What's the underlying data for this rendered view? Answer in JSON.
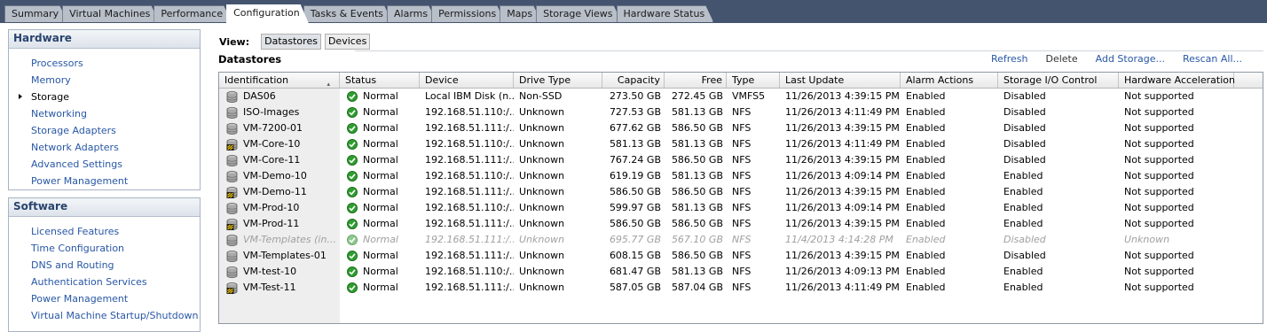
{
  "tabs": [
    "Summary",
    "Virtual Machines",
    "Performance",
    "Configuration",
    "Tasks & Events",
    "Alarms",
    "Permissions",
    "Maps",
    "Storage Views",
    "Hardware Status"
  ],
  "active_tab": "Configuration",
  "hardware": {
    "title": "Hardware",
    "items": [
      "Processors",
      "Memory",
      "Storage",
      "Networking",
      "Storage Adapters",
      "Network Adapters",
      "Advanced Settings",
      "Power Management"
    ],
    "current": "Storage"
  },
  "software": {
    "title": "Software",
    "items": [
      "Licensed Features",
      "Time Configuration",
      "DNS and Routing",
      "Authentication Services",
      "Power Management",
      "Virtual Machine Startup/Shutdown"
    ]
  },
  "view": {
    "label": "View:",
    "datastores": "Datastores",
    "devices": "Devices"
  },
  "datastores_title": "Datastores",
  "actions": {
    "refresh": "Refresh",
    "delete": "Delete",
    "add_storage": "Add Storage...",
    "rescan": "Rescan All..."
  },
  "columns": [
    "Identification",
    "Status",
    "Device",
    "Drive Type",
    "Capacity",
    "Free",
    "Type",
    "Last Update",
    "Alarm Actions",
    "Storage I/O Control",
    "Hardware Acceleration"
  ],
  "rows": [
    {
      "icon": "datastore-icon",
      "id": "DAS06",
      "status": "Normal",
      "device": "Local IBM Disk (n...",
      "drive": "Non-SSD",
      "capacity": "273.50 GB",
      "free": "272.45 GB",
      "type": "VMFS5",
      "updated": "11/26/2013 4:39:15 PM",
      "alarm": "Enabled",
      "sioc": "Disabled",
      "hwaccel": "Not supported"
    },
    {
      "icon": "datastore-icon",
      "id": "ISO-Images",
      "status": "Normal",
      "device": "192.168.51.110:/...",
      "drive": "Unknown",
      "capacity": "727.53 GB",
      "free": "581.13 GB",
      "type": "NFS",
      "updated": "11/26/2013 4:11:49 PM",
      "alarm": "Enabled",
      "sioc": "Disabled",
      "hwaccel": "Not supported"
    },
    {
      "icon": "datastore-icon",
      "id": "VM-7200-01",
      "status": "Normal",
      "device": "192.168.51.111:/...",
      "drive": "Unknown",
      "capacity": "677.62 GB",
      "free": "586.50 GB",
      "type": "NFS",
      "updated": "11/26/2013 4:39:15 PM",
      "alarm": "Enabled",
      "sioc": "Disabled",
      "hwaccel": "Not supported"
    },
    {
      "icon": "datastore-cluster-icon",
      "id": "VM-Core-10",
      "status": "Normal",
      "device": "192.168.51.110:/...",
      "drive": "Unknown",
      "capacity": "581.13 GB",
      "free": "581.13 GB",
      "type": "NFS",
      "updated": "11/26/2013 4:11:49 PM",
      "alarm": "Enabled",
      "sioc": "Disabled",
      "hwaccel": "Not supported"
    },
    {
      "icon": "datastore-icon",
      "id": "VM-Core-11",
      "status": "Normal",
      "device": "192.168.51.111:/...",
      "drive": "Unknown",
      "capacity": "767.24 GB",
      "free": "586.50 GB",
      "type": "NFS",
      "updated": "11/26/2013 4:39:15 PM",
      "alarm": "Enabled",
      "sioc": "Disabled",
      "hwaccel": "Not supported"
    },
    {
      "icon": "datastore-icon",
      "id": "VM-Demo-10",
      "status": "Normal",
      "device": "192.168.51.110:/...",
      "drive": "Unknown",
      "capacity": "619.19 GB",
      "free": "581.13 GB",
      "type": "NFS",
      "updated": "11/26/2013 4:09:14 PM",
      "alarm": "Enabled",
      "sioc": "Enabled",
      "hwaccel": "Not supported"
    },
    {
      "icon": "datastore-cluster-icon",
      "id": "VM-Demo-11",
      "status": "Normal",
      "device": "192.168.51.111:/...",
      "drive": "Unknown",
      "capacity": "586.50 GB",
      "free": "586.50 GB",
      "type": "NFS",
      "updated": "11/26/2013 4:39:15 PM",
      "alarm": "Enabled",
      "sioc": "Enabled",
      "hwaccel": "Not supported"
    },
    {
      "icon": "datastore-icon",
      "id": "VM-Prod-10",
      "status": "Normal",
      "device": "192.168.51.110:/...",
      "drive": "Unknown",
      "capacity": "599.97 GB",
      "free": "581.13 GB",
      "type": "NFS",
      "updated": "11/26/2013 4:09:14 PM",
      "alarm": "Enabled",
      "sioc": "Enabled",
      "hwaccel": "Not supported"
    },
    {
      "icon": "datastore-cluster-icon",
      "id": "VM-Prod-11",
      "status": "Normal",
      "device": "192.168.51.111:/...",
      "drive": "Unknown",
      "capacity": "586.50 GB",
      "free": "586.50 GB",
      "type": "NFS",
      "updated": "11/26/2013 4:39:15 PM",
      "alarm": "Enabled",
      "sioc": "Enabled",
      "hwaccel": "Not supported"
    },
    {
      "icon": "datastore-icon",
      "id": "VM-Templates (in...",
      "status": "Normal",
      "device": "192.168.51.111:/...",
      "drive": "Unknown",
      "capacity": "695.77 GB",
      "free": "567.10 GB",
      "type": "NFS",
      "updated": "11/4/2013 4:14:28 PM",
      "alarm": "Enabled",
      "sioc": "Disabled",
      "hwaccel": "Unknown",
      "inactive": true
    },
    {
      "icon": "datastore-icon",
      "id": "VM-Templates-01",
      "status": "Normal",
      "device": "192.168.51.111:/...",
      "drive": "Unknown",
      "capacity": "608.15 GB",
      "free": "586.50 GB",
      "type": "NFS",
      "updated": "11/26/2013 4:39:15 PM",
      "alarm": "Enabled",
      "sioc": "Disabled",
      "hwaccel": "Not supported"
    },
    {
      "icon": "datastore-icon",
      "id": "VM-test-10",
      "status": "Normal",
      "device": "192.168.51.110:/...",
      "drive": "Unknown",
      "capacity": "681.47 GB",
      "free": "581.13 GB",
      "type": "NFS",
      "updated": "11/26/2013 4:09:13 PM",
      "alarm": "Enabled",
      "sioc": "Enabled",
      "hwaccel": "Not supported"
    },
    {
      "icon": "datastore-cluster-icon",
      "id": "VM-Test-11",
      "status": "Normal",
      "device": "192.168.51.111:/...",
      "drive": "Unknown",
      "capacity": "587.05 GB",
      "free": "587.04 GB",
      "type": "NFS",
      "updated": "11/26/2013 4:11:49 PM",
      "alarm": "Enabled",
      "sioc": "Enabled",
      "hwaccel": "Not supported"
    }
  ]
}
